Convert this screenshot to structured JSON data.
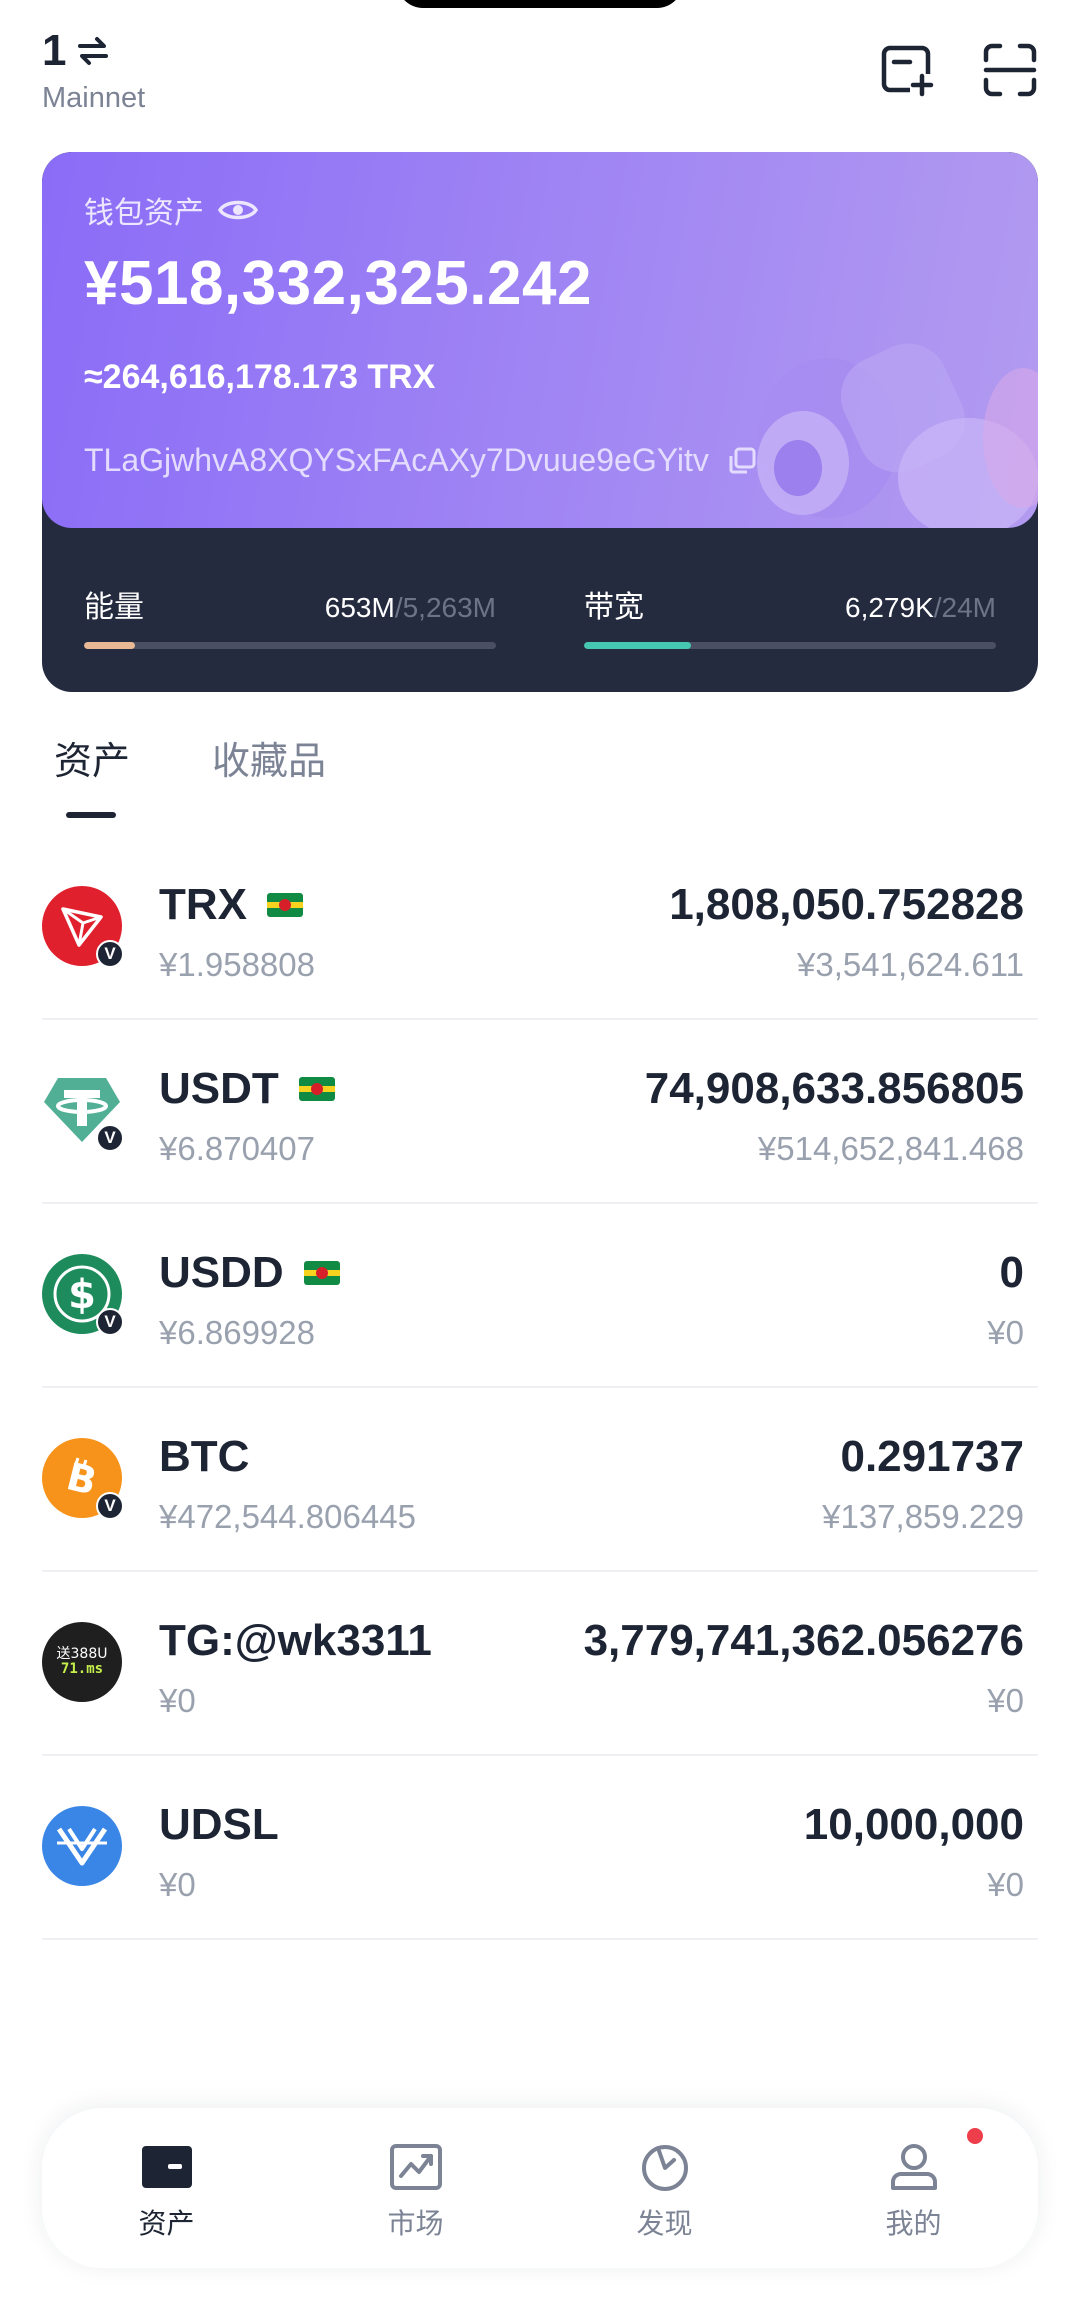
{
  "header": {
    "wallet_number": "1",
    "network": "Mainnet"
  },
  "card": {
    "label": "钱包资产",
    "total": "¥518,332,325.242",
    "trx_equiv": "≈264,616,178.173 TRX",
    "address": "TLaGjwhvA8XQYSxFAcAXy7Dvuue9eGYitv"
  },
  "resources": {
    "energy": {
      "label": "能量",
      "used": "653M",
      "total": "/5,263M",
      "fraction": 0.124
    },
    "bandwidth": {
      "label": "带宽",
      "used": "6,279K",
      "total": "/24M",
      "fraction": 0.26
    }
  },
  "tabs": [
    "资产",
    "收藏品"
  ],
  "assets": [
    {
      "name": "TRX",
      "price": "¥1.958808",
      "amount": "1,808,050.752828",
      "value": "¥3,541,624.611"
    },
    {
      "name": "USDT",
      "price": "¥6.870407",
      "amount": "74,908,633.856805",
      "value": "¥514,652,841.468"
    },
    {
      "name": "USDD",
      "price": "¥6.869928",
      "amount": "0",
      "value": "¥0"
    },
    {
      "name": "BTC",
      "price": "¥472,544.806445",
      "amount": "0.291737",
      "value": "¥137,859.229"
    },
    {
      "name": "TG:@wk3311",
      "price": "¥0",
      "amount": "3,779,741,362.056276",
      "value": "¥0",
      "logo_text": [
        "送388U",
        "71.ms"
      ]
    },
    {
      "name": "UDSL",
      "price": "¥0",
      "amount": "10,000,000",
      "value": "¥0"
    }
  ],
  "badge_letter": "V",
  "nav": {
    "assets": "资产",
    "market": "市场",
    "discover": "发现",
    "mine": "我的"
  },
  "colors": {
    "energy_fill": "#e9b894",
    "bandwidth_fill": "#46c7b0",
    "card_gradient_start": "#8a6cf7",
    "card_bottom": "#242b3f",
    "notification_dot": "#ee3d4b"
  }
}
